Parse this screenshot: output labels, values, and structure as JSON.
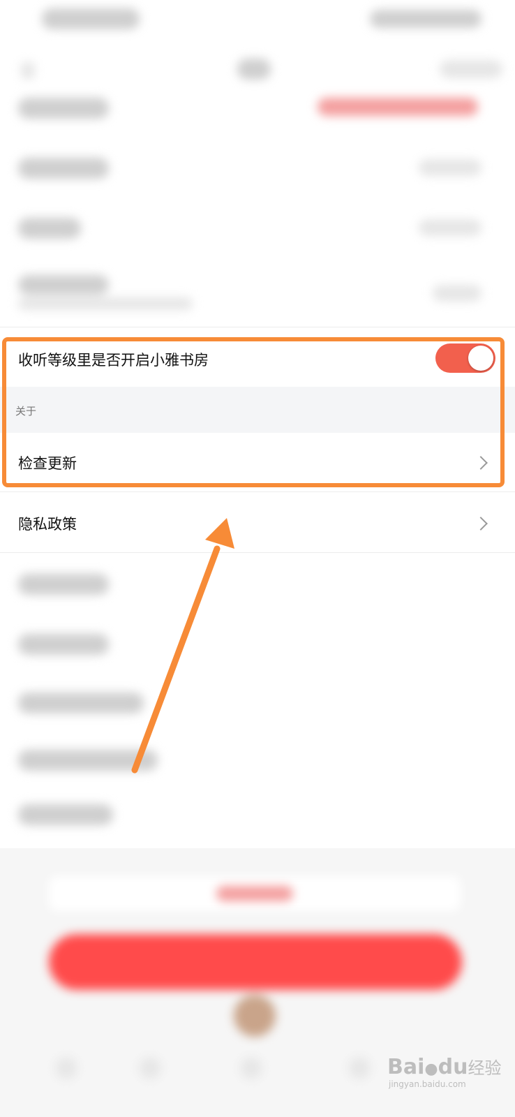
{
  "settings": {
    "toggle_row": {
      "label": "收听等级里是否开启小雅书房",
      "enabled": true
    },
    "section_about": {
      "title": "关于"
    },
    "check_update": {
      "label": "检查更新"
    },
    "privacy_policy": {
      "label": "隐私政策"
    }
  },
  "colors": {
    "accent": "#f2604d",
    "highlight": "#f78b37",
    "primary_button": "#ff4b4b"
  },
  "watermark": {
    "brand": "Bai",
    "brand2": "du",
    "cn": "经验",
    "url": "jingyan.baidu.com"
  },
  "icons": [
    "chevron-right-icon",
    "arrow-annotation",
    "paw-icon"
  ]
}
